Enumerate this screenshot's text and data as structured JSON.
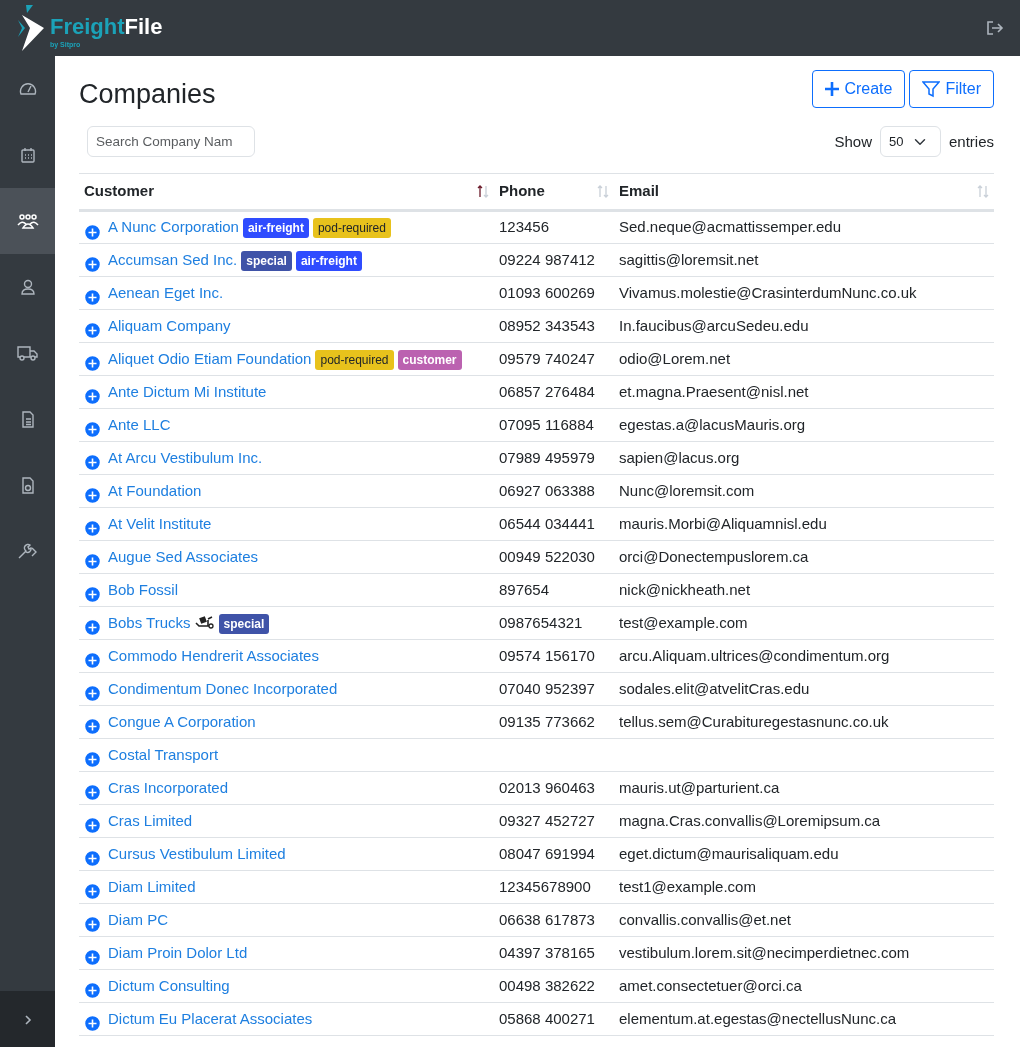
{
  "brand": {
    "name_part_1": "Freight",
    "name_part_2": "File",
    "byline": "by Sitpro"
  },
  "sidebar": {
    "items": [
      {
        "kind": "dashboard",
        "selected": false
      },
      {
        "kind": "calendar",
        "selected": false
      },
      {
        "kind": "people",
        "selected": true
      },
      {
        "kind": "user",
        "selected": false
      },
      {
        "kind": "truck",
        "selected": false
      },
      {
        "kind": "document",
        "selected": false
      },
      {
        "kind": "report",
        "selected": false
      },
      {
        "kind": "tools",
        "selected": false
      }
    ]
  },
  "page": {
    "title": "Companies",
    "buttons": [
      {
        "kind": "create",
        "label": "Create"
      },
      {
        "kind": "filter",
        "label": "Filter"
      }
    ]
  },
  "search": {
    "placeholder": "Search Company Nam"
  },
  "length": {
    "label_before": "Show",
    "value": "50",
    "label_after": "entries"
  },
  "table": {
    "columns": [
      {
        "label": "Customer",
        "sorted": true
      },
      {
        "label": "Phone",
        "sorted": false
      },
      {
        "label": "Email",
        "sorted": false
      }
    ],
    "rows": [
      {
        "customer": "A Nunc Corporation",
        "tags": [
          {
            "label": "air-freight",
            "color": "#2f4cff"
          },
          {
            "label": "pod-required",
            "color": "#e8c21c"
          }
        ],
        "phone": "123456",
        "email": "Sed.neque@acmattissemper.edu"
      },
      {
        "customer": "Accumsan Sed Inc.",
        "tags": [
          {
            "label": "special",
            "color": "#3f53a8"
          },
          {
            "label": "air-freight",
            "color": "#2f4cff"
          }
        ],
        "phone": "09224 987412",
        "email": "sagittis@loremsit.net"
      },
      {
        "customer": "Aenean Eget Inc.",
        "phone": "01093 600269",
        "email": "Vivamus.molestie@CrasinterdumNunc.co.uk"
      },
      {
        "customer": "Aliquam Company",
        "phone": "08952 343543",
        "email": "In.faucibus@arcuSedeu.edu"
      },
      {
        "customer": "Aliquet Odio Etiam Foundation",
        "tags": [
          {
            "label": "pod-required",
            "color": "#e8c21c"
          },
          {
            "label": "customer",
            "color": "#bb62b0"
          }
        ],
        "phone": "09579 740247",
        "email": "odio@Lorem.net"
      },
      {
        "customer": "Ante Dictum Mi Institute",
        "phone": "06857 276484",
        "email": "et.magna.Praesent@nisl.net"
      },
      {
        "customer": "Ante LLC",
        "phone": "07095 116884",
        "email": "egestas.a@lacusMauris.org"
      },
      {
        "customer": "At Arcu Vestibulum Inc.",
        "phone": "07989 495979",
        "email": "sapien@lacus.org"
      },
      {
        "customer": "At Foundation",
        "phone": "06927 063388",
        "email": "Nunc@loremsit.com"
      },
      {
        "customer": "At Velit Institute",
        "phone": "06544 034441",
        "email": "mauris.Morbi@Aliquamnisl.edu"
      },
      {
        "customer": "Augue Sed Associates",
        "phone": "00949 522030",
        "email": "orci@Donectempuslorem.ca"
      },
      {
        "customer": "Bob Fossil",
        "phone": "897654",
        "email": "nick@nickheath.net"
      },
      {
        "customer": "Bobs Trucks",
        "handling_flag": true,
        "tags": [
          {
            "label": "special",
            "color": "#3f53a8"
          }
        ],
        "phone": "0987654321",
        "email": "test@example.com"
      },
      {
        "customer": "Commodo Hendrerit Associates",
        "phone": "09574 156170",
        "email": "arcu.Aliquam.ultrices@condimentum.org"
      },
      {
        "customer": "Condimentum Donec Incorporated",
        "phone": "07040 952397",
        "email": "sodales.elit@atvelitCras.edu"
      },
      {
        "customer": "Congue A Corporation",
        "phone": "09135 773662",
        "email": "tellus.sem@Curabituregestasnunc.co.uk"
      },
      {
        "customer": "Costal Transport"
      },
      {
        "customer": "Cras Incorporated",
        "phone": "02013 960463",
        "email": "mauris.ut@parturient.ca"
      },
      {
        "customer": "Cras Limited",
        "phone": "09327 452727",
        "email": "magna.Cras.convallis@Loremipsum.ca"
      },
      {
        "customer": "Cursus Vestibulum Limited",
        "phone": "08047 691994",
        "email": "eget.dictum@maurisaliquam.edu"
      },
      {
        "customer": "Diam Limited",
        "phone": "12345678900",
        "email": "test1@example.com"
      },
      {
        "customer": "Diam PC",
        "phone": "06638 617873",
        "email": "convallis.convallis@et.net"
      },
      {
        "customer": "Diam Proin Dolor Ltd",
        "phone": "04397 378165",
        "email": "vestibulum.lorem.sit@necimperdietnec.com"
      },
      {
        "customer": "Dictum Consulting",
        "phone": "00498 382622",
        "email": "amet.consectetuer@orci.ca"
      },
      {
        "customer": "Dictum Eu Placerat Associates",
        "phone": "05868 400271",
        "email": "elementum.at.egestas@nectellusNunc.ca"
      }
    ]
  }
}
